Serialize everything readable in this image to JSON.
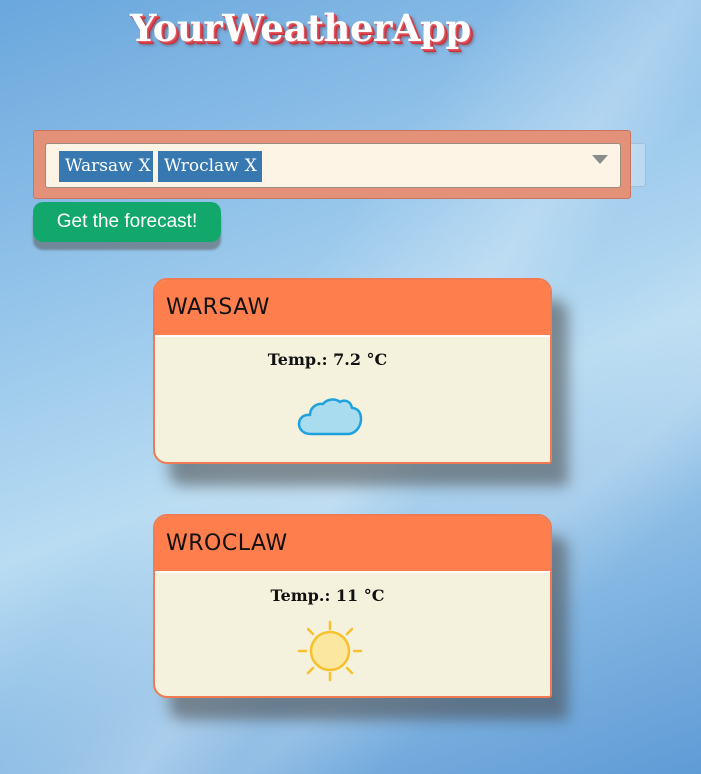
{
  "app": {
    "title": "YourWeatherApp"
  },
  "city_select": {
    "selected": [
      {
        "label": "Warsaw",
        "remove_label": "X"
      },
      {
        "label": "Wroclaw",
        "remove_label": "X"
      }
    ]
  },
  "forecast_button": {
    "label": "Get the forecast!"
  },
  "cards": [
    {
      "city": "WARSAW",
      "temp_label": "Temp.: 7.2 °C",
      "icon": "cloud-icon"
    },
    {
      "city": "WROCLAW",
      "temp_label": "Temp.: 11 °C",
      "icon": "sun-icon"
    }
  ],
  "colors": {
    "card_header": "#fe7e4e",
    "card_body": "#f4f1dc",
    "chip": "#3778b0",
    "button": "#12a86c",
    "select_frame": "#e4917a"
  }
}
